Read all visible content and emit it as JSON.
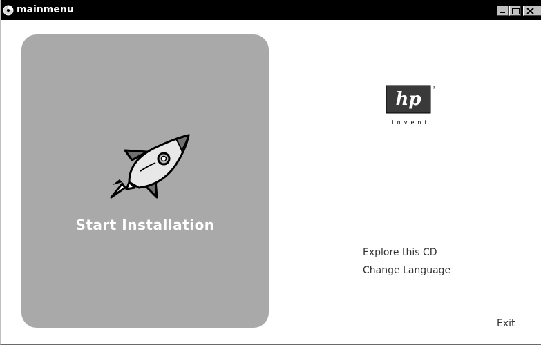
{
  "window": {
    "title": "mainmenu",
    "title_icon": "cd-disc-icon"
  },
  "main": {
    "start_label": "Start Installation",
    "start_icon": "rocket-icon"
  },
  "brand": {
    "logo_letters": "hp",
    "tagline": "invent",
    "registered_mark": "®"
  },
  "menu": {
    "explore_label": "Explore this CD",
    "language_label": "Change Language",
    "exit_label": "Exit"
  },
  "colors": {
    "panel": "#a9a9a9",
    "titlebar": "#000000",
    "link_text": "#333333"
  }
}
